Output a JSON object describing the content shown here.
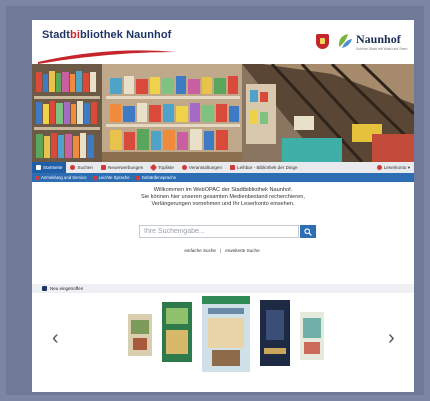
{
  "header": {
    "brand_part1": "Stadt",
    "brand_part2": "bi",
    "brand_part3": "bliothek Naunhof",
    "city_name": "Naunhof",
    "city_tagline": "Schöne Stadt mit Wald und Seen"
  },
  "nav": {
    "items": [
      {
        "label": "Startseite",
        "icon": "home-icon"
      },
      {
        "label": "Suchen",
        "icon": "search-icon"
      },
      {
        "label": "Neuerwerbungen",
        "icon": "calendar-icon"
      },
      {
        "label": "Topliste",
        "icon": "star-icon"
      },
      {
        "label": "Veranstaltungen",
        "icon": "clock-icon"
      },
      {
        "label": "Leihbar - Bibliothek der Dinge",
        "icon": "bike-icon"
      }
    ],
    "account": "Leserkonto ▾"
  },
  "subnav": {
    "items": [
      "Anmeldung und Service",
      "Leichte Sprache",
      "Gebärdensprache"
    ]
  },
  "welcome": {
    "line1": "Willkommen im WebOPAC der Stadtbibliothek Naunhof.",
    "line2": "Sie können hier unseren gesamten Medienbestand recherchieren,",
    "line3": "Verlängerungen vornehmen und Ihr Leserkonto einsehen."
  },
  "search": {
    "placeholder": "Ihre Sucheingabe...",
    "simple": "einfache Suche",
    "extended": "erweiterte Suche",
    "separator": "|"
  },
  "new_arrivals": {
    "title": "Neu eingetroffen"
  },
  "carousel": {
    "prev": "‹",
    "next": "›"
  },
  "colors": {
    "brand_blue": "#1f3565",
    "brand_red": "#c6252b",
    "nav_blue": "#2c6db3"
  }
}
